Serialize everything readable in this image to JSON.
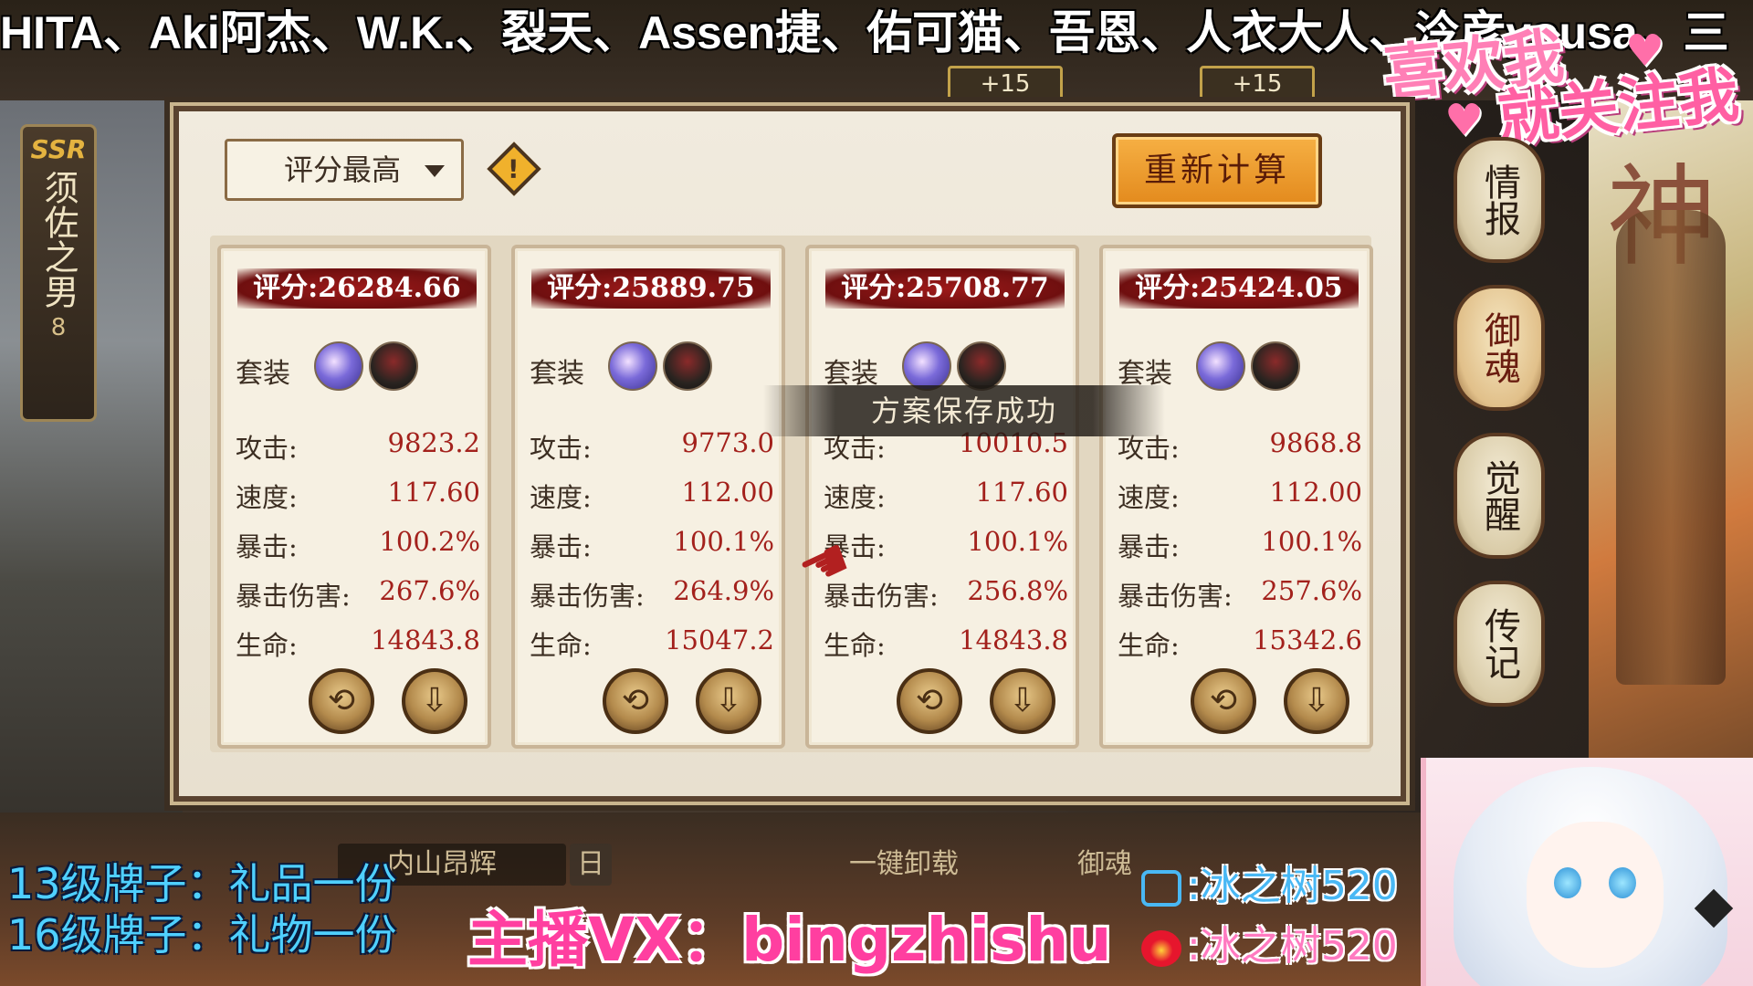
{
  "top_banner": {
    "thanks_text": "HITA、Aki阿杰、W.K.、裂天、Assen捷、佑可猫、吾恩、人衣大人、泠彦yousa、三",
    "plus_badges": [
      "+15",
      "+15"
    ]
  },
  "follow_sticker": {
    "line1": "喜欢我",
    "line2": "就关注我"
  },
  "character_tag": {
    "rarity": "SSR",
    "name": "须佐之男",
    "level": "8"
  },
  "side_menu": [
    {
      "label": "情报",
      "active": false
    },
    {
      "label": "御魂",
      "active": true
    },
    {
      "label": "觉醒",
      "active": false
    },
    {
      "label": "传记",
      "active": false
    }
  ],
  "toolbar": {
    "sort_label": "评分最高",
    "warn_glyph": "!",
    "recalc_label": "重新计算"
  },
  "toast": "方案保存成功",
  "stat_labels": {
    "set": "套装",
    "attack": "攻击:",
    "speed": "速度:",
    "crit": "暴击:",
    "crit_damage": "暴击伤害:",
    "hp": "生命:"
  },
  "cards": [
    {
      "score": "评分:26284.66",
      "attack": "9823.2",
      "speed": "117.60",
      "crit": "100.2%",
      "crit_damage": "267.6%",
      "hp": "14843.8"
    },
    {
      "score": "评分:25889.75",
      "attack": "9773.0",
      "speed": "112.00",
      "crit": "100.1%",
      "crit_damage": "264.9%",
      "hp": "15047.2"
    },
    {
      "score": "评分:25708.77",
      "attack": "10010.5",
      "speed": "117.60",
      "crit": "100.1%",
      "crit_damage": "256.8%",
      "hp": "14843.8"
    },
    {
      "score": "评分:25424.05",
      "attack": "9868.8",
      "speed": "112.00",
      "crit": "100.1%",
      "crit_damage": "257.6%",
      "hp": "15342.6"
    }
  ],
  "card_icons": {
    "set1": "soul-set-icon-blue",
    "set2": "soul-set-icon-dark",
    "swap": "swap-icon",
    "equip": "download-equip-icon"
  },
  "bottom_bar": {
    "plan_name": "内山昂辉",
    "day": "日",
    "unload": "一键卸载",
    "soul_label": "御魂"
  },
  "overlays": {
    "reward_13": "13级牌子：礼品一份",
    "reward_16": "16级牌子：礼物一份",
    "vx": "主播VX：bingzhishu",
    "bilibili": ":冰之树520",
    "weibo": ":冰之树520"
  },
  "colors": {
    "accent_red": "#a3211c",
    "score_banner": "#8a1515",
    "recalc_orange": "#f0a033",
    "overlay_pink": "#ff3fa0",
    "overlay_blue": "#4fd0ff"
  }
}
